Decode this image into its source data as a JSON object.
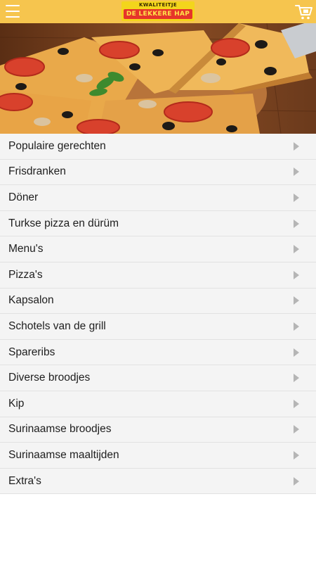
{
  "header": {
    "logo_tagline": "KWALITEITJE",
    "logo_name": "DE LEKKERE HAP",
    "menu_icon": "hamburger-icon",
    "cart_icon": "cart-icon",
    "background_color": "#f6c54e"
  },
  "hero": {
    "image": "pizza-photo"
  },
  "categories": [
    "Populaire gerechten",
    "Frisdranken",
    "Döner",
    "Turkse pizza en dürüm",
    "Menu's",
    "Pizza's",
    "Kapsalon",
    "Schotels van de grill",
    "Spareribs",
    "Diverse broodjes",
    "Kip",
    "Surinaamse broodjes",
    "Surinaamse maaltijden",
    "Extra's"
  ],
  "row_icon": "chevron-right-icon"
}
